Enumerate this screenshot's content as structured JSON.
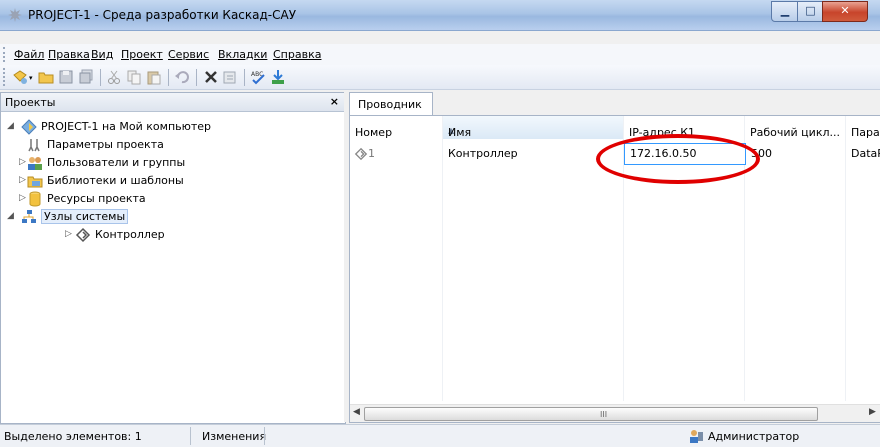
{
  "window": {
    "title": "PROJECT-1 - Среда разработки Каскад-САУ",
    "controls": {
      "minimize": "▁",
      "maximize": "□",
      "close": "✕"
    }
  },
  "menu": [
    "Файл",
    "Правка",
    "Вид",
    "Проект",
    "Сервис",
    "Вкладки",
    "Справка"
  ],
  "toolbar_icons": [
    "new-item-icon",
    "open-folder-icon",
    "save-icon",
    "save-all-icon",
    "cut-icon",
    "copy-icon",
    "paste-icon",
    "undo-icon",
    "delete-icon",
    "properties-icon",
    "spellcheck-icon",
    "build-icon"
  ],
  "projects_panel": {
    "title": "Проекты",
    "close": "×",
    "tree": [
      {
        "label": "PROJECT-1 на Мой компьютер",
        "icon": "project-icon",
        "expanded": true
      },
      {
        "label": "Параметры проекта",
        "icon": "settings-icon"
      },
      {
        "label": "Пользователи и группы",
        "icon": "users-icon"
      },
      {
        "label": "Библиотеки и шаблоны",
        "icon": "library-icon"
      },
      {
        "label": "Ресурсы проекта",
        "icon": "resources-icon"
      },
      {
        "label": "Узлы системы",
        "icon": "network-icon",
        "selected": true
      },
      {
        "label": "Контроллер",
        "icon": "controller-icon"
      }
    ]
  },
  "explorer": {
    "tab": "Проводник",
    "columns": [
      "Номер",
      "Имя",
      "IP-адрес К1",
      "Рабочий цикл...",
      "Парам"
    ],
    "rows": [
      {
        "number": "1",
        "name": "Контроллер",
        "ip": "172.16.0.50",
        "cycle": "500",
        "param": "DataP"
      }
    ],
    "scroll": {
      "left": "◀",
      "right": "▶",
      "grip": "III"
    }
  },
  "status": {
    "selected": "Выделено элементов: 1",
    "changes": "Изменения",
    "user": "Администратор"
  },
  "colors": {
    "accent": "#3399ff",
    "annotation": "#e00000",
    "title_gradient": "#a9c4e6"
  }
}
